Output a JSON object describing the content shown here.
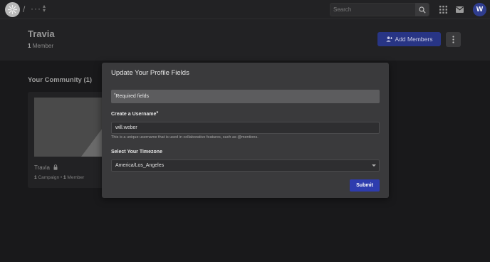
{
  "topbar": {
    "slash": "/",
    "breadcrumb_more": "···",
    "search_placeholder": "Search",
    "avatar_initial": "W"
  },
  "header": {
    "title": "Travia",
    "member_count": "1",
    "member_label": "Member",
    "add_members_label": "Add Members"
  },
  "community": {
    "heading": "Your Community (1)",
    "card": {
      "name": "Travia",
      "campaign_count": "1",
      "campaign_label": "Campaign",
      "separator": "•",
      "member_count": "1",
      "member_label": "Member"
    }
  },
  "modal": {
    "title": "Update Your Profile Fields",
    "required_star": "*",
    "required_text": "Required fields",
    "username_label": "Create a Username",
    "username_star": "*",
    "username_value": "will.weber",
    "username_help": "This is a unique username that is used in collaborative features, such as @mentions.",
    "timezone_label": "Select Your Timezone",
    "timezone_value": "America/Los_Angeles",
    "submit_label": "Submit"
  },
  "colors": {
    "accent": "#2e3cae",
    "add_members_bg": "#283585",
    "avatar_bg": "#2f3d8f"
  },
  "icons": [
    "logo-icon",
    "updown-chevron-icon",
    "search-icon",
    "apps-grid-icon",
    "mail-icon",
    "add-user-icon",
    "more-vertical-icon",
    "lock-icon",
    "dropdown-arrow-icon"
  ]
}
